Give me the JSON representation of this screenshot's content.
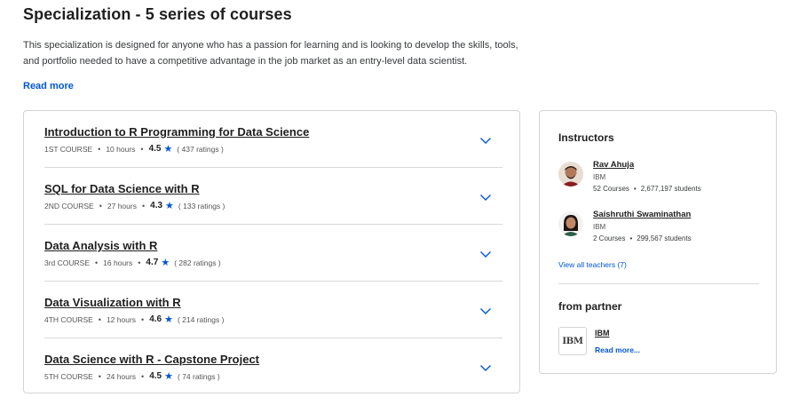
{
  "header": {
    "title": "Specialization - 5 series of courses",
    "description": "This specialization is designed for anyone who has a passion for learning and is looking to develop the skills, tools, and portfolio needed to have a competitive advantage in the job market as an entry-level data scientist.",
    "read_more": "Read more"
  },
  "courses": [
    {
      "title": "Introduction to R Programming for Data Science",
      "order": "1ST COURSE",
      "hours": "10 hours",
      "rating": "4.5",
      "ratings_count": "( 437 ratings )"
    },
    {
      "title": "SQL for Data Science with R",
      "order": "2ND COURSE",
      "hours": "27 hours",
      "rating": "4.3",
      "ratings_count": "( 133 ratings )"
    },
    {
      "title": "Data Analysis with R",
      "order": "3rd COURSE",
      "hours": "16 hours",
      "rating": "4.7",
      "ratings_count": "( 282 ratings )"
    },
    {
      "title": "Data Visualization with R",
      "order": "4TH COURSE",
      "hours": "12 hours",
      "rating": "4.6",
      "ratings_count": "( 214 ratings )"
    },
    {
      "title": "Data Science with R - Capstone Project",
      "order": "5TH COURSE",
      "hours": "24 hours",
      "rating": "4.5",
      "ratings_count": "( 74 ratings )"
    }
  ],
  "instructors_section": {
    "heading": "Instructors",
    "instructors": [
      {
        "name": "Rav Ahuja",
        "org": "IBM",
        "courses": "52 Courses",
        "students": "2,677,197 students"
      },
      {
        "name": "Saishruthi Swaminathan",
        "org": "IBM",
        "courses": "2 Courses",
        "students": "299,567 students"
      }
    ],
    "view_all": "View all teachers (7)"
  },
  "partner_section": {
    "heading": "from partner",
    "logo_text": "IBM",
    "name": "IBM",
    "read_more": "Read more..."
  },
  "icons": {
    "star": "star-icon",
    "chevron": "chevron-down-icon"
  },
  "colors": {
    "accent": "#0056d2",
    "text": "#1f1f1f",
    "border": "#d4d4d4"
  }
}
